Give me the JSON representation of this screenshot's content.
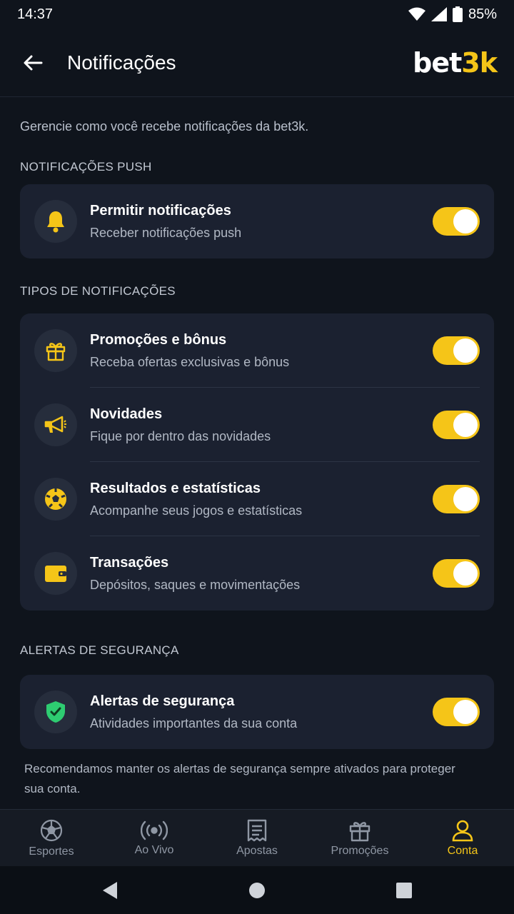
{
  "status_bar": {
    "time": "14:37",
    "battery": "85%"
  },
  "header": {
    "title": "Notificações",
    "brand_white": "bet",
    "brand_yellow": "3k"
  },
  "intro": "Gerencie como você recebe notificações da bet3k.",
  "sections": {
    "push": {
      "label": "NOTIFICAÇÕES PUSH",
      "rows": [
        {
          "title": "Permitir notificações",
          "subtitle": "Receber notificações push",
          "icon": "bell-icon",
          "enabled": true
        }
      ]
    },
    "types": {
      "label": "TIPOS DE NOTIFICAÇÕES",
      "rows": [
        {
          "title": "Promoções e bônus",
          "subtitle": "Receba ofertas exclusivas e bônus",
          "icon": "gift-icon",
          "enabled": true
        },
        {
          "title": "Novidades",
          "subtitle": "Fique por dentro das novidades",
          "icon": "megaphone-icon",
          "enabled": true
        },
        {
          "title": "Resultados e estatísticas",
          "subtitle": "Acompanhe seus jogos e estatísticas",
          "icon": "soccer-ball-icon",
          "enabled": true
        },
        {
          "title": "Transações",
          "subtitle": "Depósitos, saques e movimentações",
          "icon": "wallet-icon",
          "enabled": true
        }
      ]
    },
    "security": {
      "label": "ALERTAS DE SEGURANÇA",
      "rows": [
        {
          "title": "Alertas de segurança",
          "subtitle": "Atividades importantes da sua conta",
          "icon": "shield-check-icon",
          "enabled": true
        }
      ]
    }
  },
  "footnote": "Recomendamos manter os alertas de segurança sempre ativados para proteger sua conta.",
  "bottom_nav": {
    "items": [
      {
        "label": "Esportes",
        "icon": "soccer-ball-icon"
      },
      {
        "label": "Ao Vivo",
        "icon": "broadcast-icon"
      },
      {
        "label": "Apostas",
        "icon": "receipt-icon"
      },
      {
        "label": "Promoções",
        "icon": "gift-icon"
      },
      {
        "label": "Conta",
        "icon": "user-icon",
        "active": true
      }
    ]
  },
  "colors": {
    "accent": "#f5c518",
    "background": "#0f141c",
    "card": "#1b2130",
    "shield": "#2ecc71"
  }
}
